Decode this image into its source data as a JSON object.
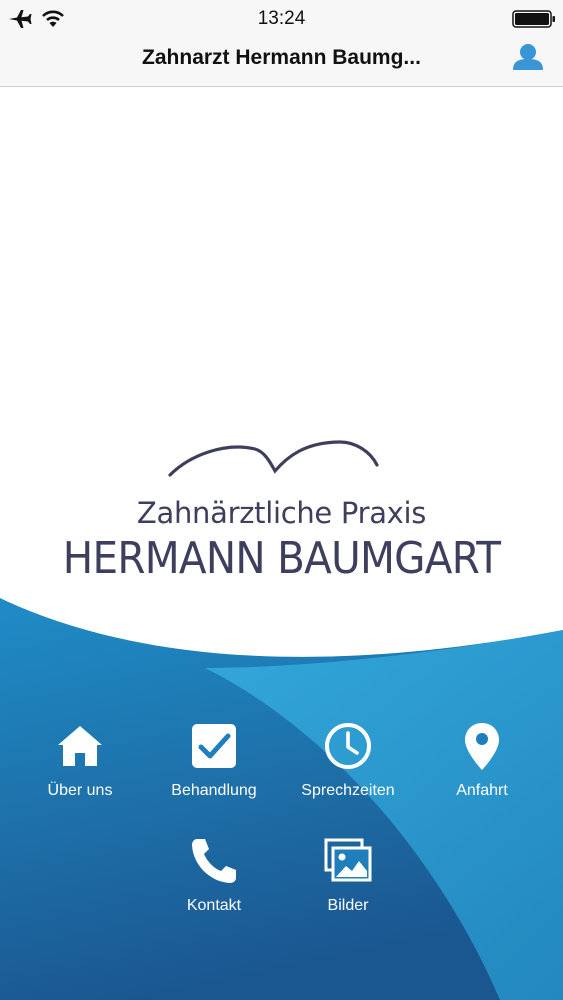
{
  "status_bar": {
    "time": "13:24"
  },
  "nav": {
    "title": "Zahnarzt Hermann Baumg..."
  },
  "logo": {
    "subtitle": "Zahnärztliche Praxis",
    "name": "HERMANN BAUMGART"
  },
  "menu": [
    {
      "label": "Über uns",
      "icon": "home-icon"
    },
    {
      "label": "Behandlung",
      "icon": "checkbox-icon"
    },
    {
      "label": "Sprechzeiten",
      "icon": "clock-icon"
    },
    {
      "label": "Anfahrt",
      "icon": "map-pin-icon"
    },
    {
      "label": "Kontakt",
      "icon": "phone-icon"
    },
    {
      "label": "Bilder",
      "icon": "images-icon"
    }
  ],
  "colors": {
    "accent": "#3a95d6",
    "blue_light": "#2ea3d2",
    "blue_dark": "#1a5e96",
    "logo_text": "#3e3f5e"
  }
}
